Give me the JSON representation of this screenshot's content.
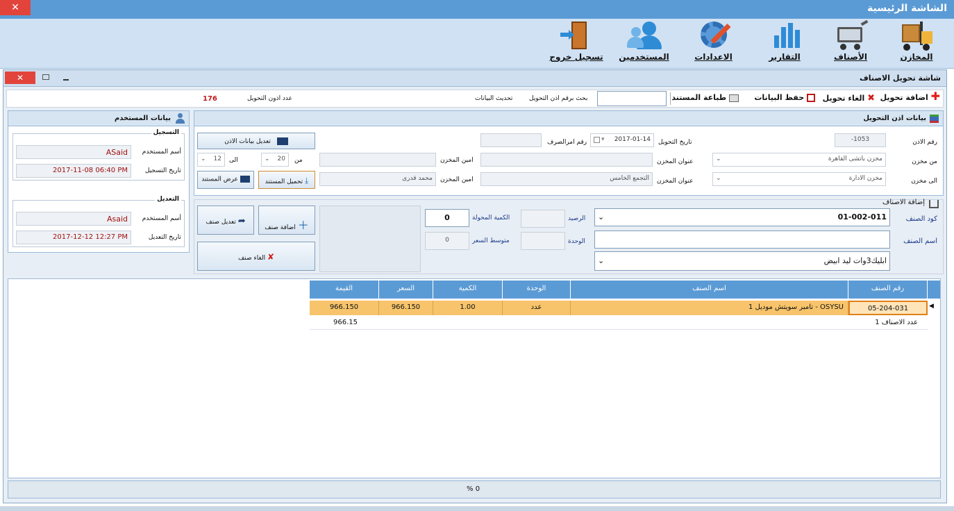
{
  "app_title": "الشاشة الرئيسية",
  "ribbon": [
    {
      "label": "المخازن",
      "icon": "forklift-icon"
    },
    {
      "label": "الأصناف",
      "icon": "cart-icon"
    },
    {
      "label": "التقارير",
      "icon": "bar-chart-icon"
    },
    {
      "label": "الاعدادات",
      "icon": "settings-wrench-icon"
    },
    {
      "label": "المستخدمين",
      "icon": "users-icon"
    },
    {
      "label": "تسجيل خروج",
      "icon": "exit-door-icon"
    }
  ],
  "screen_title": "شاشة تحويل الاصناف",
  "toolbar": {
    "add": "اضافة تحويل",
    "cancel": "الغاء تحويل",
    "save": "حفظ البيانات",
    "print": "طباعة المستند",
    "search_label": "بحث برقم اذن التحويل",
    "search_value": "",
    "refresh": "تحديث البيانات",
    "count_label": "عدد اذون التحويل",
    "count_value": "176"
  },
  "permit": {
    "header": "بيانات اذن التحويل",
    "permit_no_label": "رقم الاذن",
    "permit_no": "-1053",
    "date_label": "تاريخ التحويل",
    "date": "2017-01-14",
    "disburse_label": "رقم امرالصرف",
    "disburse": "",
    "edit_button": "تعديل بيانات الاذن",
    "from_store_label": "من مخزن",
    "from_store": "مخزن باتشى القاهرة",
    "from_address_label": "عنوان المخزن",
    "from_address": "",
    "from_keeper_label": "امين المخزن",
    "from_keeper": "",
    "from_label": "من",
    "from_value": "20",
    "to_label": "الى",
    "to_value": "12",
    "to_store_label": "الى مخزن",
    "to_store": "مخزن الادارة",
    "to_address_label": "عنوان المخزن",
    "to_address": "التجمع الخامس",
    "to_keeper_label": "امين المخزن",
    "to_keeper": "محمد قدرى",
    "upload_button": "تحميل المستند",
    "view_button": "عرض المستند"
  },
  "user_panel": {
    "header": "بيانات المستخدم",
    "reg_title": "التسجيل",
    "reg_user_label": "أسم المستخدم",
    "reg_user": "ASaid",
    "reg_date_label": "تاريخ التسجيل",
    "reg_date": "2017-11-08 06:40 PM",
    "mod_title": "التعديل",
    "mod_user_label": "أسم المستخدم",
    "mod_user": "Asaid",
    "mod_date_label": "تاريخ التعديل",
    "mod_date": "2017-12-12 12:27 PM"
  },
  "items_section": {
    "header": "إضافة الاصناف",
    "code_label": "كود الصنف",
    "code": "01-002-011",
    "name_label": "اسم الصنف",
    "name": "",
    "desc": "ابليك3وات ليد ابيض",
    "balance_label": "الرصيد",
    "balance": "",
    "unit_label": "الوحدة",
    "unit": "",
    "qty_label": "الكمية المحولة",
    "qty": "0",
    "avg_label": "متوسط السعر",
    "avg": "0",
    "add_button": "اضافة صنف",
    "edit_button": "تعديل صنف",
    "cancel_button": "الغاء صنف"
  },
  "grid": {
    "columns": [
      "رقم الصنف",
      "اسم الصنف",
      "الوحدة",
      "الكمية",
      "السعر",
      "القيمة"
    ],
    "rows": [
      [
        "05-204-031",
        "تامبر سويتش موديل 1 - OSYSU",
        "عدد",
        "1.00",
        "966.150",
        "966.150"
      ]
    ],
    "summary_label": "عدد الاصناف 1",
    "summary_total": "966.15"
  },
  "status": {
    "progress": "0 %"
  }
}
